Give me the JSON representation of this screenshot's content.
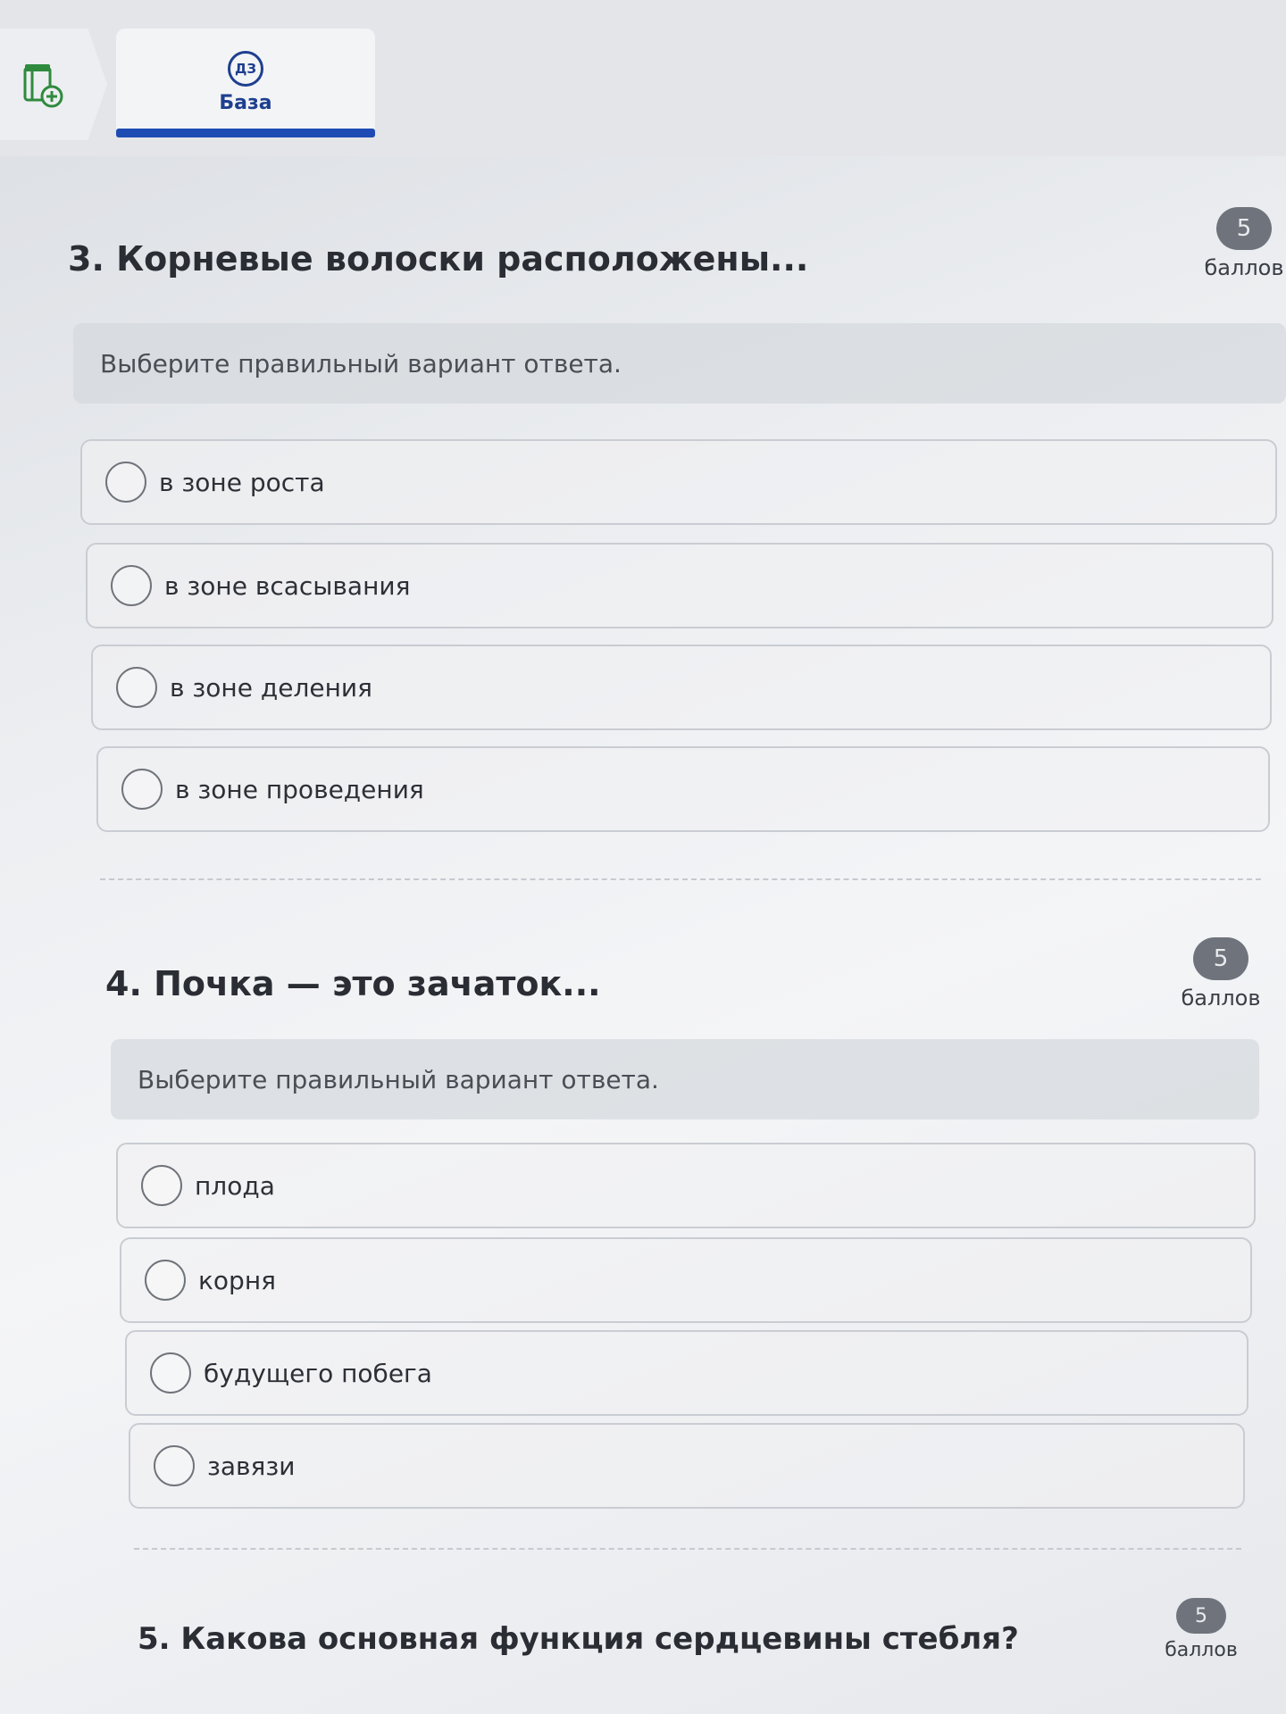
{
  "tabs": {
    "home_icon": "document-add-icon",
    "active": {
      "badge": "ДЗ",
      "label": "База"
    }
  },
  "questions": [
    {
      "title": "3. Корневые волоски расположены...",
      "score": "5",
      "score_label": "баллов",
      "hint": "Выберите правильный вариант ответа.",
      "options": [
        "в зоне роста",
        "в зоне всасывания",
        "в зоне деления",
        "в зоне проведения"
      ]
    },
    {
      "title": "4. Почка — это зачаток...",
      "score": "5",
      "score_label": "баллов",
      "hint": "Выберите правильный вариант ответа.",
      "options": [
        "плода",
        "корня",
        "будущего побега",
        "завязи"
      ]
    },
    {
      "title": "5. Какова основная функция сердцевины стебля?",
      "score": "5",
      "score_label": "баллов"
    }
  ],
  "colors": {
    "accent": "#1e4bb3",
    "badge": "#6f747c",
    "border": "#c9ccd2"
  }
}
